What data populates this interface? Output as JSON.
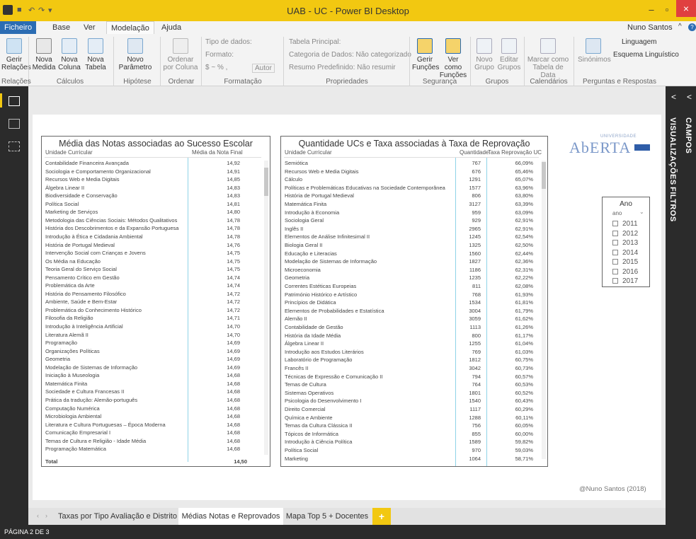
{
  "window": {
    "title": "UAB - UC - Power BI Desktop",
    "user": "Nuno Santos",
    "minimize": "–",
    "maximize": "▫",
    "close": "×"
  },
  "colors": {
    "accent": "#f2c811",
    "dark": "#2b2b2b",
    "column_line": "#8fd3e8"
  },
  "ribbon_tabs": [
    "Ficheiro",
    "Base",
    "Ver",
    "Modelação",
    "Ajuda"
  ],
  "ribbon": {
    "gerir_relacoes": "Gerir Relações",
    "nova_medida": "Nova Medida",
    "nova_coluna": "Nova Coluna",
    "nova_tabela": "Nova Tabela",
    "novo_parametro": "Novo Parâmetro",
    "ordenar_por_coluna": "Ordenar por Coluna",
    "tipo_dados": "Tipo de dados:",
    "formato": "Formato:",
    "currency_percent": "$ ~ % ,",
    "autor": "Autor",
    "tabela_principal": "Tabela Principal:",
    "categoria_dados": "Categoria de Dados: Não categorizado",
    "resumo_predefinido": "Resumo Predefinido: Não resumir",
    "gerir_funcoes": "Gerir Funções",
    "ver_como_funcoes": "Ver como Funções",
    "novo_grupo": "Novo Grupo",
    "editar_grupos": "Editar Grupos",
    "marcar_tabela_data": "Marcar como Tabela de Data",
    "sinonimos": "Sinónimos",
    "linguagem": "Linguagem",
    "esquema_linguistico": "Esquema Linguístico",
    "groups": [
      "Relações",
      "Cálculos",
      "Hipótese",
      "Ordenar",
      "Formatação",
      "Propriedades",
      "Segurança",
      "Grupos",
      "Calendários",
      "Perguntas e Respostas"
    ]
  },
  "side_panels": {
    "visualizacoes": "VISUALIZAÇÕES",
    "filtros": "FILTROS",
    "campos": "CAMPOS",
    "collapse": "<"
  },
  "table1": {
    "title": "Média das Notas associadas ao Sucesso Escolar",
    "col1": "Unidade Curricular",
    "col2": "Média da Nota Final",
    "rows": [
      [
        "Contabilidade Financeira Avançada",
        "14,92"
      ],
      [
        "Sociologia e Comportamento Organizacional",
        "14,91"
      ],
      [
        "Recursos Web e Media Digitais",
        "14,85"
      ],
      [
        "Álgebra Linear II",
        "14,83"
      ],
      [
        "Biodiversidade e Conservação",
        "14,83"
      ],
      [
        "Política Social",
        "14,81"
      ],
      [
        "Marketing de Serviços",
        "14,80"
      ],
      [
        "Metodologia das Ciências Sociais: Métodos Qualitativos",
        "14,78"
      ],
      [
        "História dos Descobrimentos e da Expansão Portuguesa",
        "14,78"
      ],
      [
        "Introdução à Ética e Cidadania Ambiental",
        "14,78"
      ],
      [
        "História de Portugal Medieval",
        "14,76"
      ],
      [
        "Intervenção Social com Crianças e Jovens",
        "14,75"
      ],
      [
        "Os Média na Educação",
        "14,75"
      ],
      [
        "Teoria Geral do Serviço Social",
        "14,75"
      ],
      [
        "Pensamento Crítico em Gestão",
        "14,74"
      ],
      [
        "Problemática da Arte",
        "14,74"
      ],
      [
        "História do Pensamento Filosófico",
        "14,72"
      ],
      [
        "Ambiente, Saúde e Bem-Estar",
        "14,72"
      ],
      [
        "Problemática do Conhecimento Histórico",
        "14,72"
      ],
      [
        "Filosofia da Religião",
        "14,71"
      ],
      [
        "Introdução à Inteligência Artificial",
        "14,70"
      ],
      [
        "Literatura Alemã II",
        "14,70"
      ],
      [
        "Programação",
        "14,69"
      ],
      [
        "Organizações Políticas",
        "14,69"
      ],
      [
        "Geometria",
        "14,69"
      ],
      [
        "Modelação de Sistemas de Informação",
        "14,69"
      ],
      [
        "Iniciação à Museologia",
        "14,68"
      ],
      [
        "Matemática Finita",
        "14,68"
      ],
      [
        "Sociedade e Cultura Francesas II",
        "14,68"
      ],
      [
        "Prática da tradução: Alemão-português",
        "14,68"
      ],
      [
        "Computação Numérica",
        "14,68"
      ],
      [
        "Microbiologia Ambiental",
        "14,68"
      ],
      [
        "Literatura e Cultura Portuguesas – Época Moderna",
        "14,68"
      ],
      [
        "Comunicação Empresarial I",
        "14,68"
      ],
      [
        "Temas de Cultura e Religião - Idade Média",
        "14,68"
      ],
      [
        "Programação Matemática",
        "14,68"
      ]
    ],
    "total_label": "Total",
    "total_value": "14,50"
  },
  "table2": {
    "title": "Quantidade UCs e Taxa associadas à Taxa de Reprovação",
    "col1": "Unidade Curricular",
    "col2": "Quantidade",
    "col3": "Taxa Reprovação UC",
    "rows": [
      [
        "Semiótica",
        "767",
        "66,09%"
      ],
      [
        "Recursos Web e Media Digitais",
        "676",
        "65,46%"
      ],
      [
        "Cálculo",
        "1291",
        "65,07%"
      ],
      [
        "Políticas e Problemáticas Educativas na Sociedade Contemporânea",
        "1577",
        "63,96%"
      ],
      [
        "História de Portugal Medieval",
        "806",
        "63,80%"
      ],
      [
        "Matemática Finita",
        "3127",
        "63,39%"
      ],
      [
        "Introdução à Economia",
        "959",
        "63,09%"
      ],
      [
        "Sociologia Geral",
        "929",
        "62,91%"
      ],
      [
        "Inglês II",
        "2965",
        "62,91%"
      ],
      [
        "Elementos de Análise Infinitesimal II",
        "1245",
        "62,54%"
      ],
      [
        "Biologia Geral II",
        "1325",
        "62,50%"
      ],
      [
        "Educação e Literacias",
        "1560",
        "62,44%"
      ],
      [
        "Modelação de Sistemas de Informação",
        "1827",
        "62,36%"
      ],
      [
        "Microeconomia",
        "1186",
        "62,31%"
      ],
      [
        "Geometria",
        "1235",
        "62,22%"
      ],
      [
        "Correntes Estéticas Europeias",
        "811",
        "62,08%"
      ],
      [
        "Património Histórico e Artístico",
        "768",
        "61,93%"
      ],
      [
        "Princípios de Didática",
        "1534",
        "61,81%"
      ],
      [
        "Elementos de Probabilidades e Estatística",
        "3004",
        "61,79%"
      ],
      [
        "Alemão II",
        "3059",
        "61,62%"
      ],
      [
        "Contabilidade de Gestão",
        "1113",
        "61,26%"
      ],
      [
        "História da Idade Média",
        "800",
        "61,17%"
      ],
      [
        "Álgebra Linear II",
        "1255",
        "61,04%"
      ],
      [
        "Introdução aos Estudos Literários",
        "769",
        "61,03%"
      ],
      [
        "Laboratório de Programação",
        "1812",
        "60,75%"
      ],
      [
        "Francês II",
        "3042",
        "60,73%"
      ],
      [
        "Técnicas de Expressão e Comunicação II",
        "794",
        "60,57%"
      ],
      [
        "Temas de Cultura",
        "764",
        "60,53%"
      ],
      [
        "Sistemas Operativos",
        "1801",
        "60,52%"
      ],
      [
        "Psicologia do Desenvolvimento I",
        "1540",
        "60,43%"
      ],
      [
        "Direito Comercial",
        "1117",
        "60,29%"
      ],
      [
        "Química e Ambiente",
        "1288",
        "60,11%"
      ],
      [
        "Temas da Cultura Clássica II",
        "756",
        "60,05%"
      ],
      [
        "Tópicos de Informática",
        "855",
        "60,00%"
      ],
      [
        "Introdução à Ciência Política",
        "1589",
        "59,82%"
      ],
      [
        "Política Social",
        "970",
        "59,03%"
      ],
      [
        "Marketing",
        "1064",
        "58,71%"
      ]
    ]
  },
  "logo": {
    "top": "UNIVERSIDADE",
    "name": "AbERTA"
  },
  "slicer": {
    "title": "Ano",
    "field": "ano",
    "years": [
      "2011",
      "2012",
      "2013",
      "2014",
      "2015",
      "2016",
      "2017"
    ]
  },
  "credit": "@Nuno Santos (2018)",
  "page_tabs": [
    "Taxas por Tipo Avaliação e Distrito",
    "Médias Notas e Reprovados",
    "Mapa Top 5 + Docentes"
  ],
  "add_page": "+",
  "status": "PÁGINA 2 DE 3"
}
